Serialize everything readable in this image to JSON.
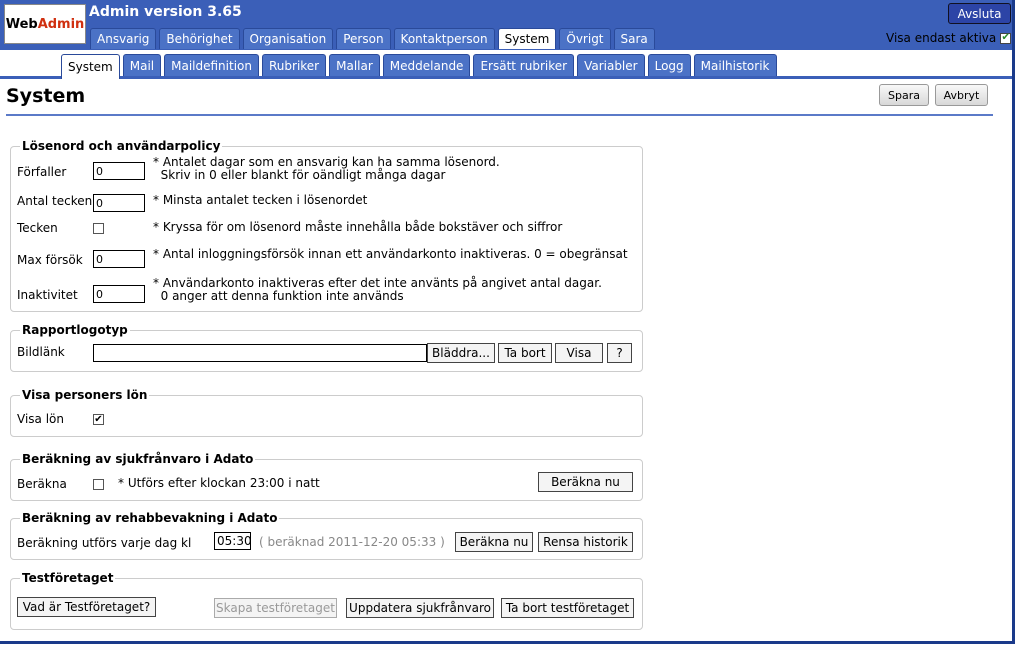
{
  "header": {
    "logo_web": "Web",
    "logo_admin": "Admin",
    "app_title": "Admin version 3.65",
    "logout_label": "Avsluta",
    "only_active_label": "Visa endast aktiva"
  },
  "top_tabs": [
    "Ansvarig",
    "Behörighet",
    "Organisation",
    "Person",
    "Kontaktperson",
    "System",
    "Övrigt",
    "Sara"
  ],
  "sub_tabs": [
    "System",
    "Mail",
    "Maildefinition",
    "Rubriker",
    "Mallar",
    "Meddelande",
    "Ersätt rubriker",
    "Variabler",
    "Logg",
    "Mailhistorik"
  ],
  "page": {
    "title": "System",
    "save_label": "Spara",
    "cancel_label": "Avbryt"
  },
  "password_policy": {
    "legend": "Lösenord och användarpolicy",
    "expires_label": "Förfaller",
    "expires_value": "0",
    "expires_note": "* Antalet dagar som en ansvarig kan ha samma lösenord.\n  Skriv in 0 eller blankt för oändligt många dagar",
    "chars_label": "Antal tecken",
    "chars_value": "0",
    "chars_note": "* Minsta antalet tecken i lösenordet",
    "sign_label": "Tecken",
    "sign_note": "* Kryssa för om lösenord måste innehålla både bokstäver och siffror",
    "max_label": "Max försök",
    "max_value": "0",
    "max_note": "* Antal inloggningsförsök innan ett användarkonto inaktiveras. 0 = obegränsat",
    "inactive_label": "Inaktivitet",
    "inactive_value": "0",
    "inactive_note": "* Användarkonto inaktiveras efter det inte använts på angivet antal dagar.\n  0 anger att denna funktion inte används"
  },
  "report_logo": {
    "legend": "Rapportlogotyp",
    "image_label": "Bildlänk",
    "image_value": "",
    "browse_label": "Bläddra...",
    "remove_label": "Ta bort",
    "show_label": "Visa",
    "help_label": "?"
  },
  "salary": {
    "legend": "Visa personers lön",
    "show_label": "Visa lön"
  },
  "sick_calc": {
    "legend": "Beräkning av sjukfrånvaro i Adato",
    "calc_label": "Beräkna",
    "calc_note": "* Utförs efter klockan 23:00 i natt",
    "calc_now_label": "Beräkna nu"
  },
  "rehab_calc": {
    "legend": "Beräkning av rehabbevakning i Adato",
    "daily_label": "Beräkning utförs varje dag kl",
    "time_value": "05:30",
    "last_run": "( beräknad 2011-12-20 05:33 )",
    "calc_now_label": "Beräkna nu",
    "clear_history_label": "Rensa historik"
  },
  "test_company": {
    "legend": "Testföretaget",
    "what_label": "Vad är Testföretaget?",
    "create_label": "Skapa testföretaget",
    "update_sick_label": "Uppdatera sjukfrånvaro",
    "delete_label": "Ta bort testföretaget"
  }
}
